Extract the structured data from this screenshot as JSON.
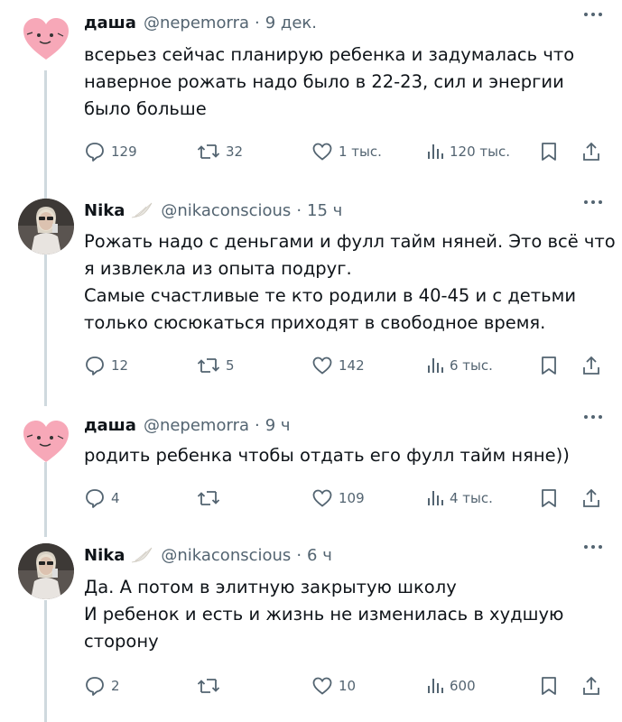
{
  "tweets": [
    {
      "author": "даша",
      "handle": "@nepemorra",
      "time": "9 дек.",
      "avatar": "heart-avatar",
      "lines": [
        "всерьез сейчас планирую ребенка и задумалась что",
        "наверное рожать надо было в 22-23, сил и энергии",
        "было больше"
      ],
      "replies": "129",
      "reposts": "32",
      "likes": "1 тыс.",
      "views": "120 тыс."
    },
    {
      "author": "Nika",
      "handle": "@nikaconscious",
      "time": "15 ч",
      "avatar": "photo-avatar",
      "badge": "wing-icon",
      "lines": [
        "Рожать надо с деньгами и фулл тайм няней. Это всё что",
        "я извлекла из опыта подруг.",
        "Самые счастливые те кто родили в 40-45 и с детьми",
        "только сюсюкаться приходят в свободное время."
      ],
      "replies": "12",
      "reposts": "5",
      "likes": "142",
      "views": "6 тыс."
    },
    {
      "author": "даша",
      "handle": "@nepemorra",
      "time": "9 ч",
      "avatar": "heart-avatar",
      "lines": [
        "родить ребенка чтобы отдать его фулл тайм няне))"
      ],
      "replies": "4",
      "reposts": "",
      "likes": "109",
      "views": "4 тыс."
    },
    {
      "author": "Nika",
      "handle": "@nikaconscious",
      "time": "6 ч",
      "avatar": "photo-avatar",
      "badge": "wing-icon",
      "lines": [
        "Да. А потом в элитную закрытую школу",
        "И ребенок и есть и жизнь не изменилась в худшую",
        "сторону"
      ],
      "replies": "2",
      "reposts": "",
      "likes": "10",
      "views": "600"
    }
  ],
  "colors": {
    "text": "#0f1419",
    "secondary": "#536471",
    "thread_line": "#cfd9de",
    "heart_pink": "#f7a8b8"
  }
}
